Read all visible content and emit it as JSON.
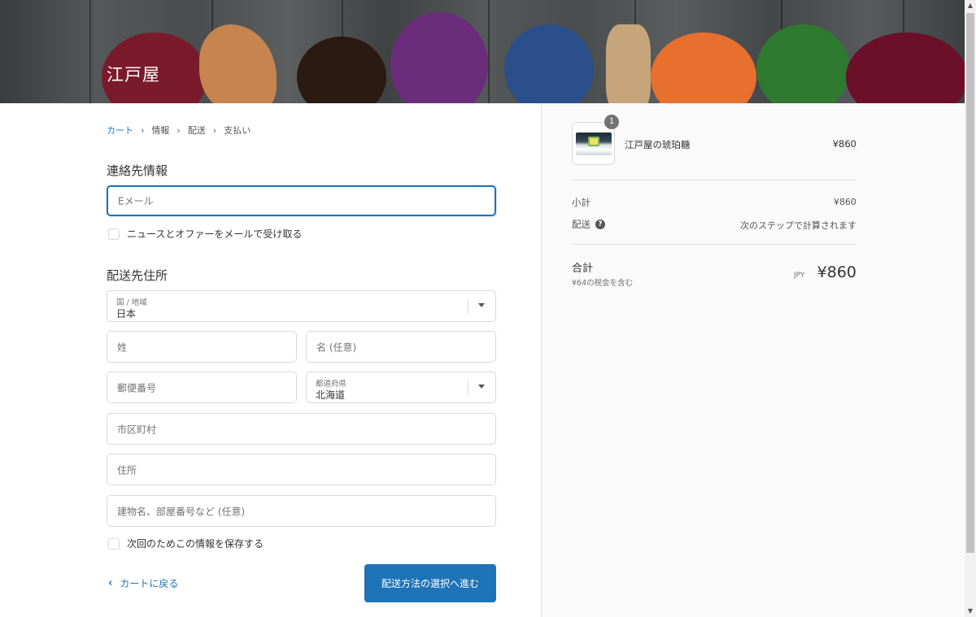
{
  "header": {
    "brand": "江戸屋"
  },
  "breadcrumb": {
    "items": [
      "カート",
      "情報",
      "配送",
      "支払い"
    ],
    "separator": "›"
  },
  "contact": {
    "heading": "連絡先情報",
    "email_placeholder": "Eメール",
    "newsletter_label": "ニュースとオファーをメールで受け取る"
  },
  "shipping": {
    "heading": "配送先住所",
    "country_label": "国 / 地域",
    "country_value": "日本",
    "last_name_placeholder": "姓",
    "first_name_placeholder": "名 (任意)",
    "postal_placeholder": "郵便番号",
    "prefecture_label": "都道府県",
    "prefecture_value": "北海道",
    "city_placeholder": "市区町村",
    "address_placeholder": "住所",
    "building_placeholder": "建物名、部屋番号など (任意)",
    "save_info_label": "次回のためこの情報を保存する"
  },
  "actions": {
    "back_label": "カートに戻る",
    "continue_label": "配送方法の選択へ進む"
  },
  "summary": {
    "item": {
      "name": "江戸屋の琥珀糖",
      "price": "¥860",
      "quantity": "1"
    },
    "subtotal_label": "小計",
    "subtotal_value": "¥860",
    "shipping_label": "配送",
    "shipping_value": "次のステップで計算されます",
    "total_label": "合計",
    "tax_note": "¥64の税金を含む",
    "currency": "JPY",
    "total_value": "¥860"
  },
  "colors": {
    "accent": "#1f73b7",
    "summary_bg": "#fafafa"
  }
}
